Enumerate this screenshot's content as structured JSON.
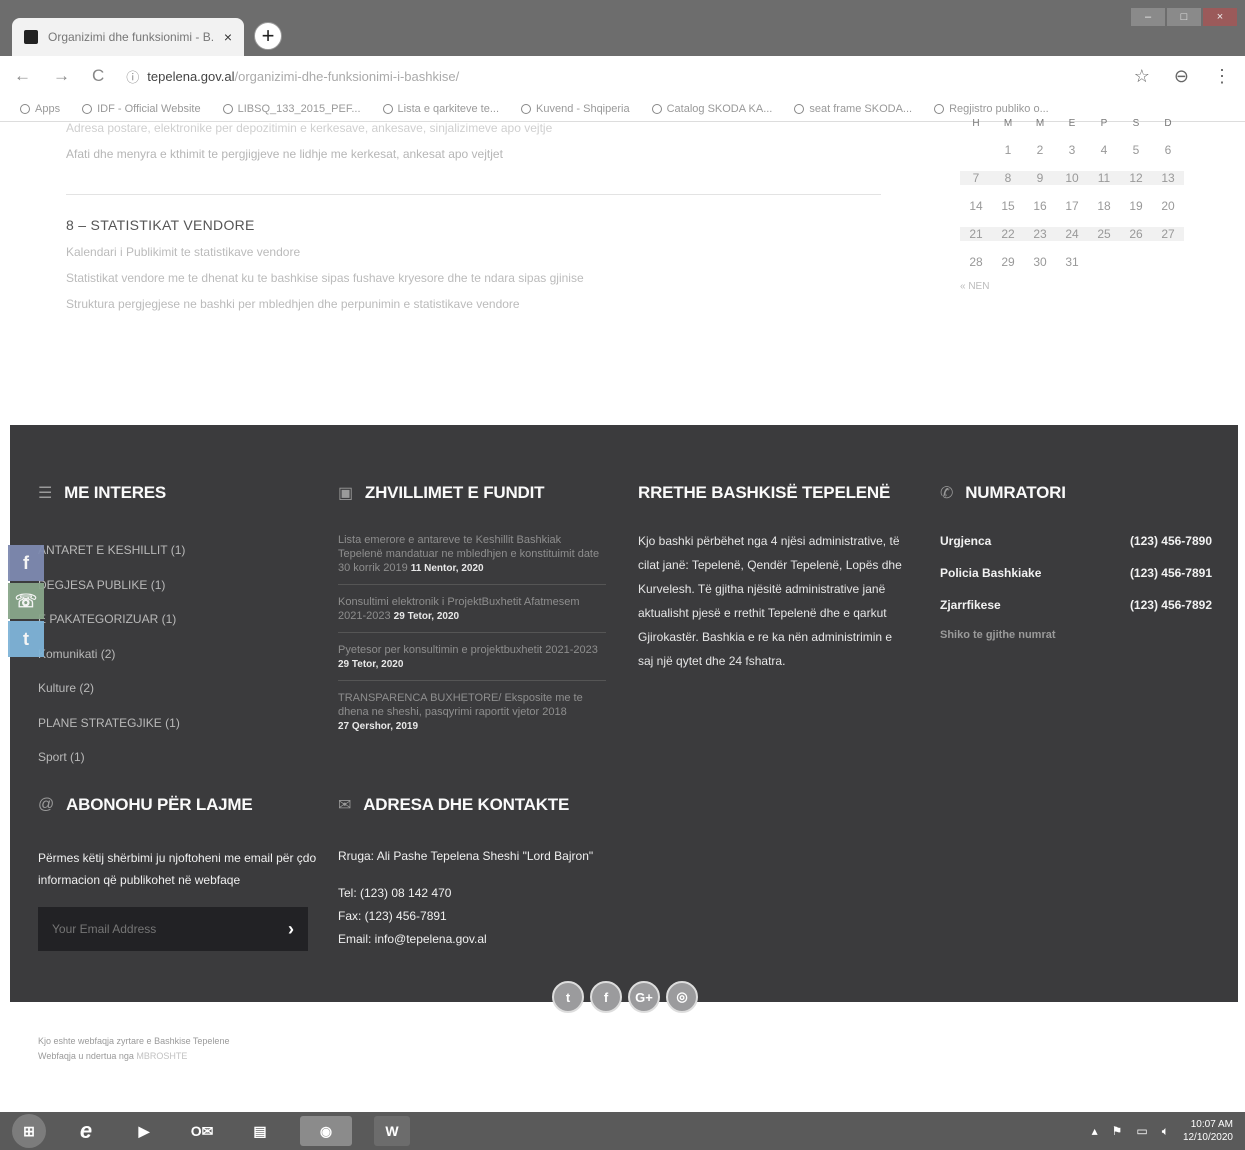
{
  "browser": {
    "tab_title": "Organizimi dhe funksionimi - B...",
    "tab_close": "×",
    "newtab": "+",
    "back": "←",
    "forward": "→",
    "reload": "C",
    "url_host": "tepelena.gov.al",
    "url_path": "/organizimi-dhe-funksionimi-i-bashkise/",
    "bookmarks": [
      "Apps",
      "IDF - Official Website",
      "LIBSQ_133_2015_PEF...",
      "Lista e qarkiteve te...",
      "Kuvend - Shqiperia",
      "Catalog SKODA KA...",
      "seat frame SKODA...",
      "Regjistro publiko o..."
    ]
  },
  "content": {
    "faded_lines": [
      "Adresa postare, elektronike per depozitimin e kerkesave, ankesave, sinjalizimeve apo vejtje",
      "Afati dhe menyra e kthimit te pergjigjeve ne lidhje me kerkesat, ankesat apo vejtjet"
    ],
    "section_title": "8 – STATISTIKAT VENDORE",
    "links": [
      "Kalendari i Publikimit te statistikave vendore",
      "Statistikat vendore me te dhenat ku te bashkise sipas fushave kryesore dhe te ndara sipas gjinise",
      "Struktura pergjegjese ne bashki per mbledhjen dhe perpunimin e statistikave vendore"
    ]
  },
  "calendar": {
    "headers": [
      "H",
      "M",
      "M",
      "E",
      "P",
      "S",
      "D"
    ],
    "weeks": [
      [
        "",
        "1",
        "2",
        "3",
        "4",
        "5",
        "6"
      ],
      [
        "7",
        "8",
        "9",
        "10",
        "11",
        "12",
        "13"
      ],
      [
        "14",
        "15",
        "16",
        "17",
        "18",
        "19",
        "20"
      ],
      [
        "21",
        "22",
        "23",
        "24",
        "25",
        "26",
        "27"
      ],
      [
        "28",
        "29",
        "30",
        "31",
        "",
        "",
        ""
      ]
    ],
    "prev": "« NEN"
  },
  "footer": {
    "interes": {
      "title": "ME INTERES",
      "items": [
        "ANTARET E KESHILLIT (1)",
        "DEGJESA PUBLIKE (1)",
        "E PAKATEGORIZUAR (1)",
        "Komunikati (2)",
        "Kulture (2)",
        "PLANE STRATEGJIKE (1)",
        "Sport (1)"
      ]
    },
    "zhvillime": {
      "title": "ZHVILLIMET E FUNDIT",
      "items": [
        {
          "text": "Lista emerore e antareve te Keshillit Bashkiak Tepelenë mandatuar ne mbledhjen e konstituimit date 30 korrik 2019",
          "date": "11 Nentor, 2020"
        },
        {
          "text": "Konsultimi elektronik i ProjektBuxhetit Afatmesem 2021-2023",
          "date": "29 Tetor, 2020"
        },
        {
          "text": "Pyetesor per konsultimin e projektbuxhetit 2021-2023",
          "date": "29 Tetor, 2020"
        },
        {
          "text": "TRANSPARENCA BUXHETORE/ Eksposite me te dhena ne sheshi, pasqyrimi raportit vjetor 2018",
          "date": "27 Qershor, 2019"
        }
      ]
    },
    "rreth": {
      "title": "RRETHE BASHKISË TEPELENË",
      "text": "Kjo bashki përbëhet nga 4 njësi administrative, të cilat janë: Tepelenë, Qendër Tepelenë, Lopës dhe Kurvelesh. Të gjitha njësitë administrative janë aktualisht pjesë e rrethit Tepelenë dhe e qarkut Gjirokastër. Bashkia e re ka nën administrimin e saj një qytet dhe 24 fshatra."
    },
    "numratori": {
      "title": "NUMRATORI",
      "rows": [
        {
          "label": "Urgjenca",
          "value": "(123) 456-7890"
        },
        {
          "label": "Policia Bashkiake",
          "value": "(123) 456-7891"
        },
        {
          "label": "Zjarrfikese",
          "value": "(123) 456-7892"
        }
      ],
      "link": "Shiko te gjithe numrat"
    },
    "abonohu": {
      "title": "ABONOHU PËR LAJME",
      "text": "Përmes këtij shërbimi ju njoftoheni me email për çdo informacion që publikohet në webfaqe",
      "placeholder": "Your Email Address",
      "submit": "›"
    },
    "adresa": {
      "title": "ADRESA DHE KONTAKTE",
      "street": "Rruga: Ali Pashe Tepelena Sheshi \"Lord Bajron\"",
      "tel": "Tel: (123) 08 142 470",
      "fax": "Fax: (123) 456-7891",
      "email": "Email: info@tepelena.gov.al"
    },
    "social": [
      "t",
      "f",
      "G+",
      "◎"
    ]
  },
  "share": [
    "f",
    "☏",
    "t"
  ],
  "credits": {
    "line1": "Kjo eshte webfaqja zyrtare e Bashkise Tepelene",
    "line2_prefix": "Webfaqja u ndertua nga",
    "line2_link": "MBROSHTE"
  },
  "taskbar": {
    "apps": [
      "e",
      "▶",
      "O✉",
      "▤",
      "◉",
      "W"
    ],
    "time": "10:07 AM",
    "date": "12/10/2020"
  }
}
